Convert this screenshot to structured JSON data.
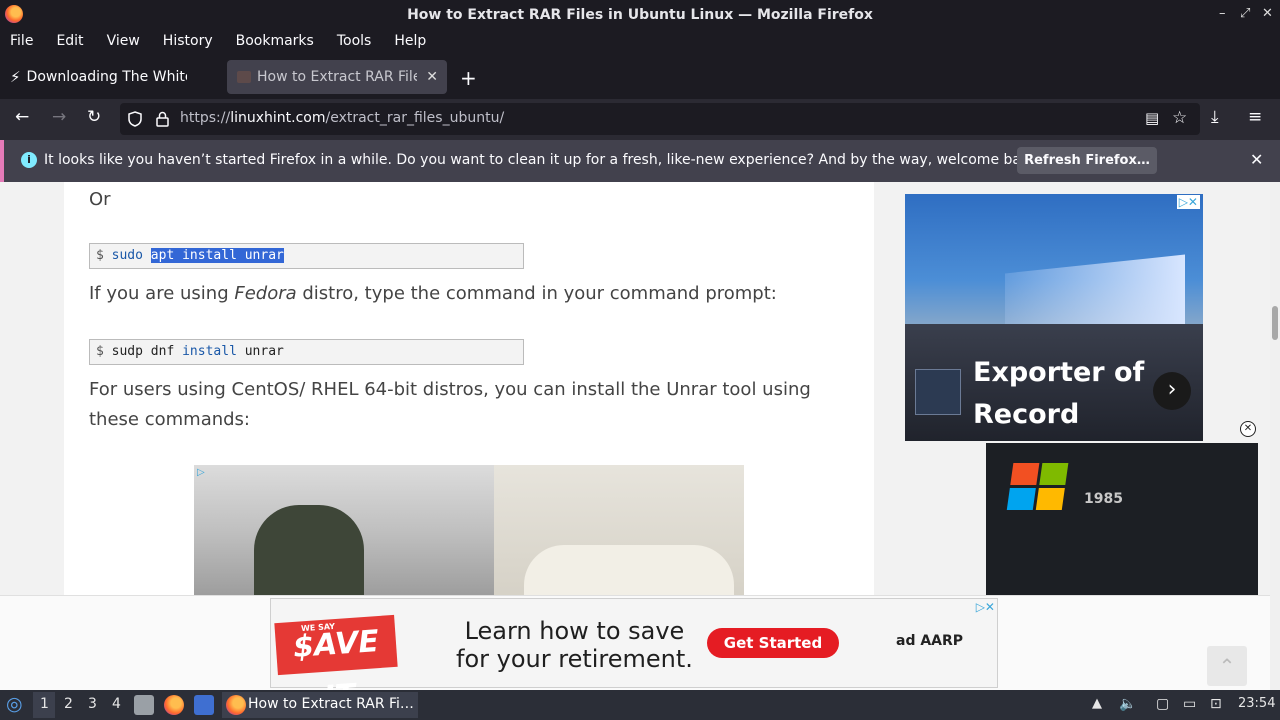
{
  "window": {
    "title": "How to Extract RAR Files in Ubuntu Linux — Mozilla Firefox",
    "controls": {
      "minimize": "–",
      "restore": "⤢",
      "close": "✕"
    }
  },
  "menu": [
    "File",
    "Edit",
    "View",
    "History",
    "Bookmarks",
    "Tools",
    "Help"
  ],
  "tabs": [
    {
      "label": "Downloading The White Hou",
      "active": false,
      "close": "✕"
    },
    {
      "label": "How to Extract RAR Files in",
      "active": true,
      "close": "✕"
    }
  ],
  "new_tab_label": "+",
  "nav": {
    "url_prefix": "https://",
    "url_domain": "linuxhint.com",
    "url_path": "/extract_rar_files_ubuntu/"
  },
  "notification": {
    "message": "It looks like you haven’t started Firefox in a while. Do you want to clean it up for a fresh, like-new experience? And by the way, welcome back!",
    "button": "Refresh Firefox…",
    "close": "✕"
  },
  "article": {
    "or_text": "Or",
    "code1": {
      "dollar": "$",
      "cmd": "sudo",
      "selected": "apt install unrar"
    },
    "para_fedora_1": "If you are using ",
    "para_fedora_em": "Fedora",
    "para_fedora_2": " distro, type the command in your command prompt:",
    "code2": {
      "dollar": "$",
      "cmd": "sudp dnf",
      "kw": "install",
      "arg": "unrar"
    },
    "para_centos": "For users using CentOS/ RHEL 64-bit distros, you can install the Unrar tool using these commands:"
  },
  "ads": {
    "sidebar": {
      "headline": "Exporter of Record",
      "arrow": "›"
    },
    "video2": {
      "year": "1985"
    },
    "bottom": {
      "we_say": "WE SAY",
      "save_it": "$AVE IT",
      "line1": "Learn how to save",
      "line2": "for your retirement.",
      "cta": "Get Started",
      "brand": "ad AARP"
    },
    "adchoices": "▷",
    "close_x": "✕"
  },
  "taskbar": {
    "workspaces": [
      "1",
      "2",
      "3",
      "4"
    ],
    "active_window": "How to Extract RAR Fi…",
    "clock": "23:54"
  },
  "colors": {
    "chrome_dark": "#1c1b22",
    "toolbar": "#2b2a33",
    "notification_accent": "#e57bb8",
    "selection": "#3367d6",
    "cta_red": "#e51c23"
  }
}
